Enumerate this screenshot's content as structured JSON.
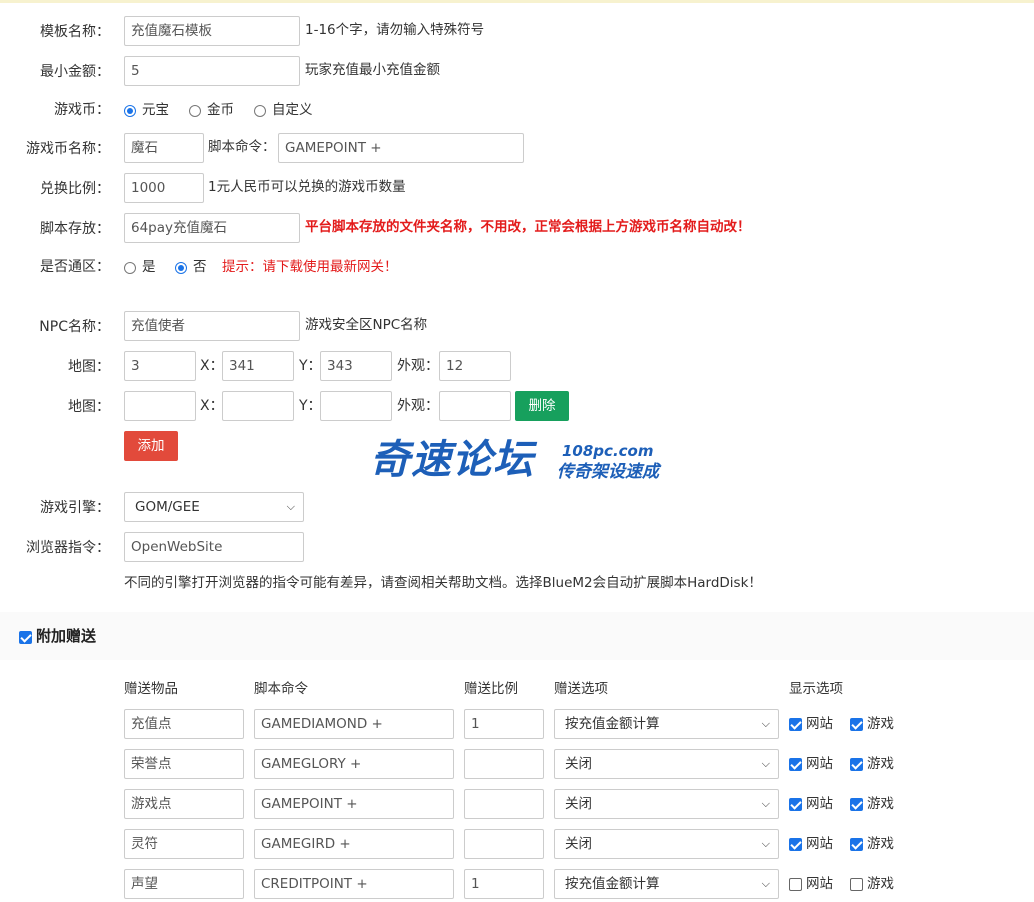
{
  "form": {
    "template_name": {
      "label": "模板名称：",
      "value": "充值魔石模板",
      "hint": "1-16个字，请勿输入特殊符号"
    },
    "min_amount": {
      "label": "最小金额：",
      "value": "5",
      "hint": "玩家充值最小充值金额"
    },
    "currency": {
      "label": "游戏币：",
      "options": [
        "元宝",
        "金币",
        "自定义"
      ],
      "selected": "元宝"
    },
    "currency_name": {
      "label": "游戏币名称：",
      "value": "魔石",
      "script_label": "脚本命令：",
      "script_value": "GAMEPOINT +"
    },
    "ratio": {
      "label": "兑换比例：",
      "value": "1000",
      "hint": "1元人民币可以兑换的游戏币数量"
    },
    "script_store": {
      "label": "脚本存放：",
      "value": "64pay充值魔石",
      "hint": "平台脚本存放的文件夹名称，不用改，正常会根据上方游戏币名称自动改！"
    },
    "cross_server": {
      "label": "是否通区：",
      "options": [
        "是",
        "否"
      ],
      "selected": "否",
      "hint": "提示：请下载使用最新网关！"
    },
    "npc_name": {
      "label": "NPC名称：",
      "value": "充值使者",
      "hint": "游戏安全区NPC名称"
    },
    "map_rows": [
      {
        "label": "地图：",
        "map": "3",
        "x_label": "X：",
        "x": "341",
        "y_label": "Y：",
        "y": "343",
        "look_label": "外观：",
        "look": "12"
      },
      {
        "label": "地图：",
        "map": "",
        "x_label": "X：",
        "x": "",
        "y_label": "Y：",
        "y": "",
        "look_label": "外观：",
        "look": "",
        "delete_label": "删除"
      }
    ],
    "add_label": "添加",
    "engine": {
      "label": "游戏引擎：",
      "value": "GOM/GEE"
    },
    "browser_cmd": {
      "label": "浏览器指令：",
      "value": "OpenWebSite",
      "hint": "不同的引擎打开浏览器的指令可能有差异，请查阅相关帮助文档。选择BlueM2会自动扩展脚本HardDisk！"
    }
  },
  "watermark": {
    "main": "奇速论坛",
    "domain": "108pc.com",
    "slogan": "传奇架设速成"
  },
  "bonus": {
    "title": "附加赠送",
    "checked": true,
    "headers": [
      "赠送物品",
      "脚本命令",
      "赠送比例",
      "赠送选项",
      "显示选项"
    ],
    "site_label": "网站",
    "game_label": "游戏",
    "rows": [
      {
        "item": "充值点",
        "cmd": "GAMEDIAMOND +",
        "ratio": "1",
        "option": "按充值金额计算",
        "site": true,
        "game": true
      },
      {
        "item": "荣誉点",
        "cmd": "GAMEGLORY +",
        "ratio": "",
        "option": "关闭",
        "site": true,
        "game": true
      },
      {
        "item": "游戏点",
        "cmd": "GAMEPOINT +",
        "ratio": "",
        "option": "关闭",
        "site": true,
        "game": true
      },
      {
        "item": "灵符",
        "cmd": "GAMEGIRD +",
        "ratio": "",
        "option": "关闭",
        "site": true,
        "game": true
      },
      {
        "item": "声望",
        "cmd": "CREDITPOINT +",
        "ratio": "1",
        "option": "按充值金额计算",
        "site": false,
        "game": false
      }
    ]
  }
}
